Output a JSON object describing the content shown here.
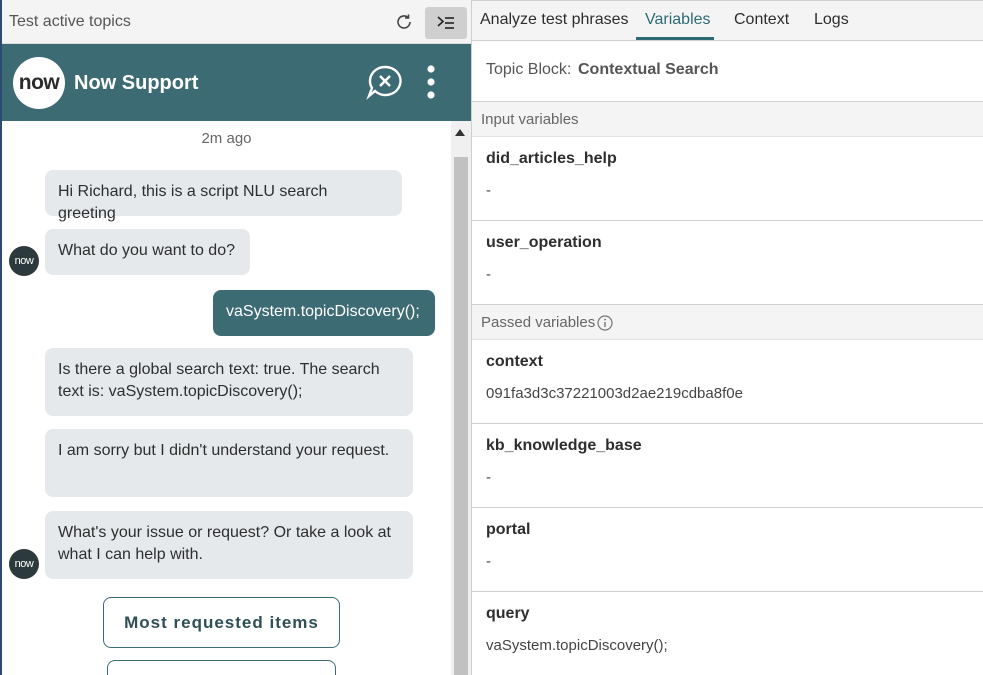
{
  "left_panel": {
    "title": "Test active topics",
    "refresh_icon": "refresh-icon",
    "collapse_icon": "collapse-panel-icon"
  },
  "chat_header": {
    "logo_text": "now",
    "name": "Now Support",
    "end_chat_icon": "end-chat-icon",
    "more_icon": "more-vertical-icon",
    "bg_color": "#3d6b73"
  },
  "chat": {
    "timestamp": "2m ago",
    "avatar_text": "now",
    "messages": [
      {
        "from": "bot",
        "text": "Hi Richard, this is a script NLU search greeting"
      },
      {
        "from": "bot",
        "text": "What do you want to do?"
      },
      {
        "from": "user",
        "text": "vaSystem.topicDiscovery();"
      },
      {
        "from": "bot",
        "text": "Is there a global search text: true. The search text is: vaSystem.topicDiscovery();"
      },
      {
        "from": "bot",
        "text": "I am sorry but I didn't understand your request."
      },
      {
        "from": "bot",
        "text": "What's your issue or request? Or take a look at what I can help with."
      }
    ],
    "buttons": [
      {
        "label": "Most requested items"
      },
      {
        "label": ""
      }
    ]
  },
  "right_panel": {
    "tabs": [
      {
        "label": "Analyze test phrases",
        "active": false
      },
      {
        "label": "Variables",
        "active": true
      },
      {
        "label": "Context",
        "active": false
      },
      {
        "label": "Logs",
        "active": false
      }
    ],
    "topic_block_label": "Topic Block:",
    "topic_block_value": "Contextual Search",
    "input_section": {
      "title": "Input variables",
      "variables": [
        {
          "name": "did_articles_help",
          "value": "-"
        },
        {
          "name": "user_operation",
          "value": "-"
        }
      ]
    },
    "passed_section": {
      "title": "Passed variables",
      "info_icon": "info-icon",
      "variables": [
        {
          "name": "context",
          "value": "091fa3d3c37221003d2ae219cdba8f0e"
        },
        {
          "name": "kb_knowledge_base",
          "value": "-"
        },
        {
          "name": "portal",
          "value": "-"
        },
        {
          "name": "query",
          "value": "vaSystem.topicDiscovery();"
        }
      ]
    },
    "accent_color": "#2c6b73"
  }
}
